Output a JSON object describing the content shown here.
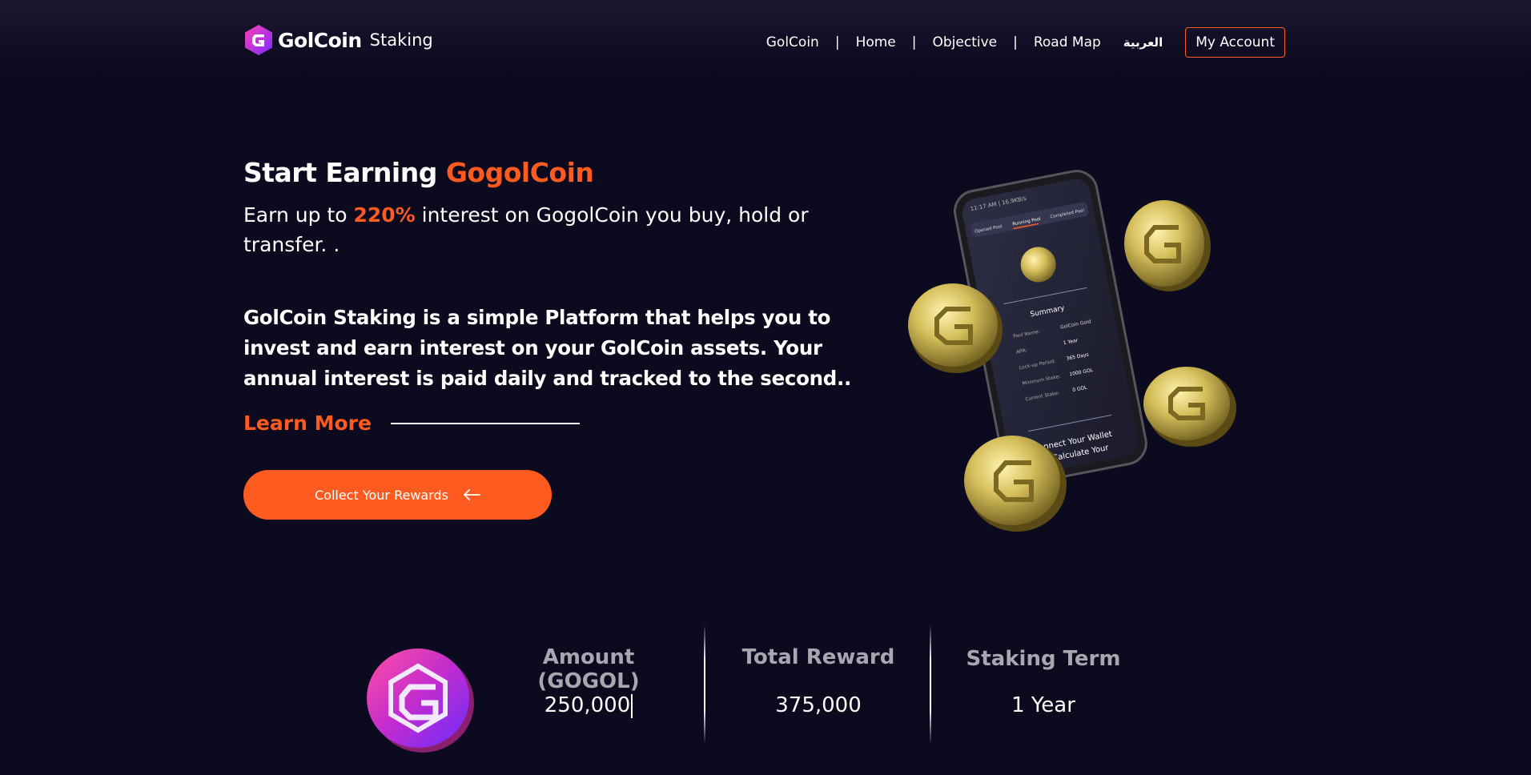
{
  "header": {
    "logo_word": "GolCoin",
    "logo_sub": "Staking",
    "nav": [
      "GolCoin",
      "Home",
      "Objective",
      "Road Map"
    ],
    "nav_separator": "|",
    "language": "العربية",
    "account_label": "My Account"
  },
  "hero": {
    "title_prefix": "Start Earning ",
    "title_accent": "GogolCoin",
    "sub_prefix": "Earn up to ",
    "sub_accent": "220%",
    "sub_suffix": " interest on GogolCoin you buy, hold or transfer. .",
    "description": "GolCoin Staking is a simple Platform that helps you to invest and earn interest on your GolCoin assets. Your annual interest is paid daily and tracked to the second..",
    "learn_more": "Learn More",
    "cta_label": "Collect Your Rewards"
  },
  "phone": {
    "status_time": "11:17 AM | 16.9KB/s",
    "tabs": [
      "Opened Pool",
      "Running Pool",
      "Completed Pool"
    ],
    "summary_title": "Summary",
    "rows": [
      {
        "label": "Pool Name:",
        "value": "GolCoin Gold"
      },
      {
        "label": "APR:",
        "value": "1 Year"
      },
      {
        "label": "Lock-up Period:",
        "value": "365 Days"
      },
      {
        "label": "Minimum Stake:",
        "value": "1000 GOL"
      },
      {
        "label": "Current Stake:",
        "value": "0 GOL"
      }
    ],
    "connect_line1": "Connect Your Wallet",
    "connect_line2": "To Calculate Your"
  },
  "stats": {
    "amount_label": "Amount (GOGOL)",
    "amount_value": "250,000",
    "reward_label": "Total Reward",
    "reward_value": "375,000",
    "term_label": "Staking Term",
    "term_value": "1 Year"
  },
  "colors": {
    "background": "#0b0a1e",
    "accent": "#ff5a1f",
    "gold": "#c9b24e",
    "muted_label": "#a7a7b0"
  }
}
